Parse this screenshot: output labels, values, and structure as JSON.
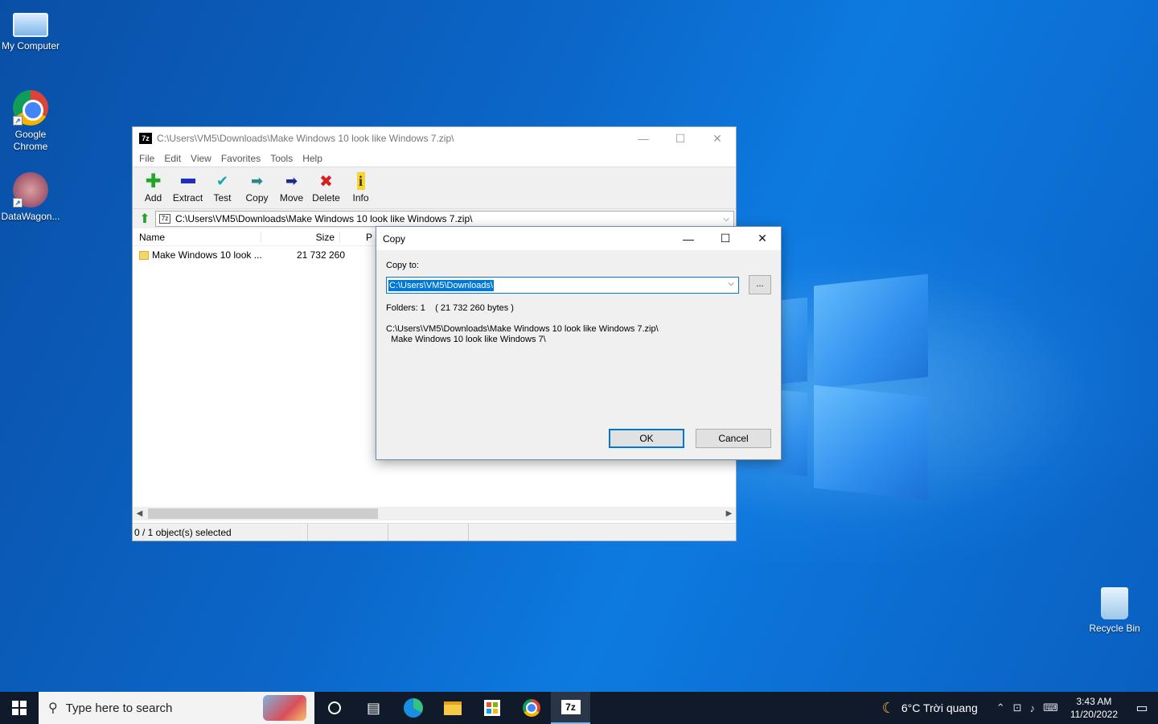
{
  "desktop": {
    "icons": [
      {
        "label": "My Computer"
      },
      {
        "label": "Google Chrome"
      },
      {
        "label": "DataWagon..."
      },
      {
        "label": "Recycle Bin"
      }
    ]
  },
  "main_window": {
    "title": "C:\\Users\\VM5\\Downloads\\Make Windows 10 look like Windows 7.zip\\",
    "app_icon_text": "7z",
    "menu": [
      "File",
      "Edit",
      "View",
      "Favorites",
      "Tools",
      "Help"
    ],
    "toolbar": [
      {
        "label": "Add",
        "icon": "add-icon"
      },
      {
        "label": "Extract",
        "icon": "extract-icon"
      },
      {
        "label": "Test",
        "icon": "test-icon"
      },
      {
        "label": "Copy",
        "icon": "copy-icon"
      },
      {
        "label": "Move",
        "icon": "move-icon"
      },
      {
        "label": "Delete",
        "icon": "delete-icon"
      },
      {
        "label": "Info",
        "icon": "info-icon"
      }
    ],
    "address": "C:\\Users\\VM5\\Downloads\\Make Windows 10 look like Windows 7.zip\\",
    "columns": {
      "name": "Name",
      "size": "Size",
      "packed": "P"
    },
    "rows": [
      {
        "name": "Make Windows 10 look ...",
        "size": "21 732 260"
      }
    ],
    "status": {
      "selection": "0 / 1 object(s) selected"
    }
  },
  "copy_dialog": {
    "title": "Copy",
    "copy_to_label": "Copy to:",
    "copy_to_value": "C:\\Users\\VM5\\Downloads\\",
    "browse_label": "...",
    "folders_line": "Folders: 1    ( 21 732 260 bytes )",
    "source_line1": "C:\\Users\\VM5\\Downloads\\Make Windows 10 look like Windows 7.zip\\",
    "source_line2": "  Make Windows 10 look like Windows 7\\",
    "ok_label": "OK",
    "cancel_label": "Cancel"
  },
  "taskbar": {
    "search_placeholder": "Type here to search",
    "weather": "6°C  Trời quang",
    "time": "3:43 AM",
    "date": "11/20/2022"
  },
  "colors": {
    "accent": "#0078d7",
    "taskbar": "#101a2b"
  }
}
